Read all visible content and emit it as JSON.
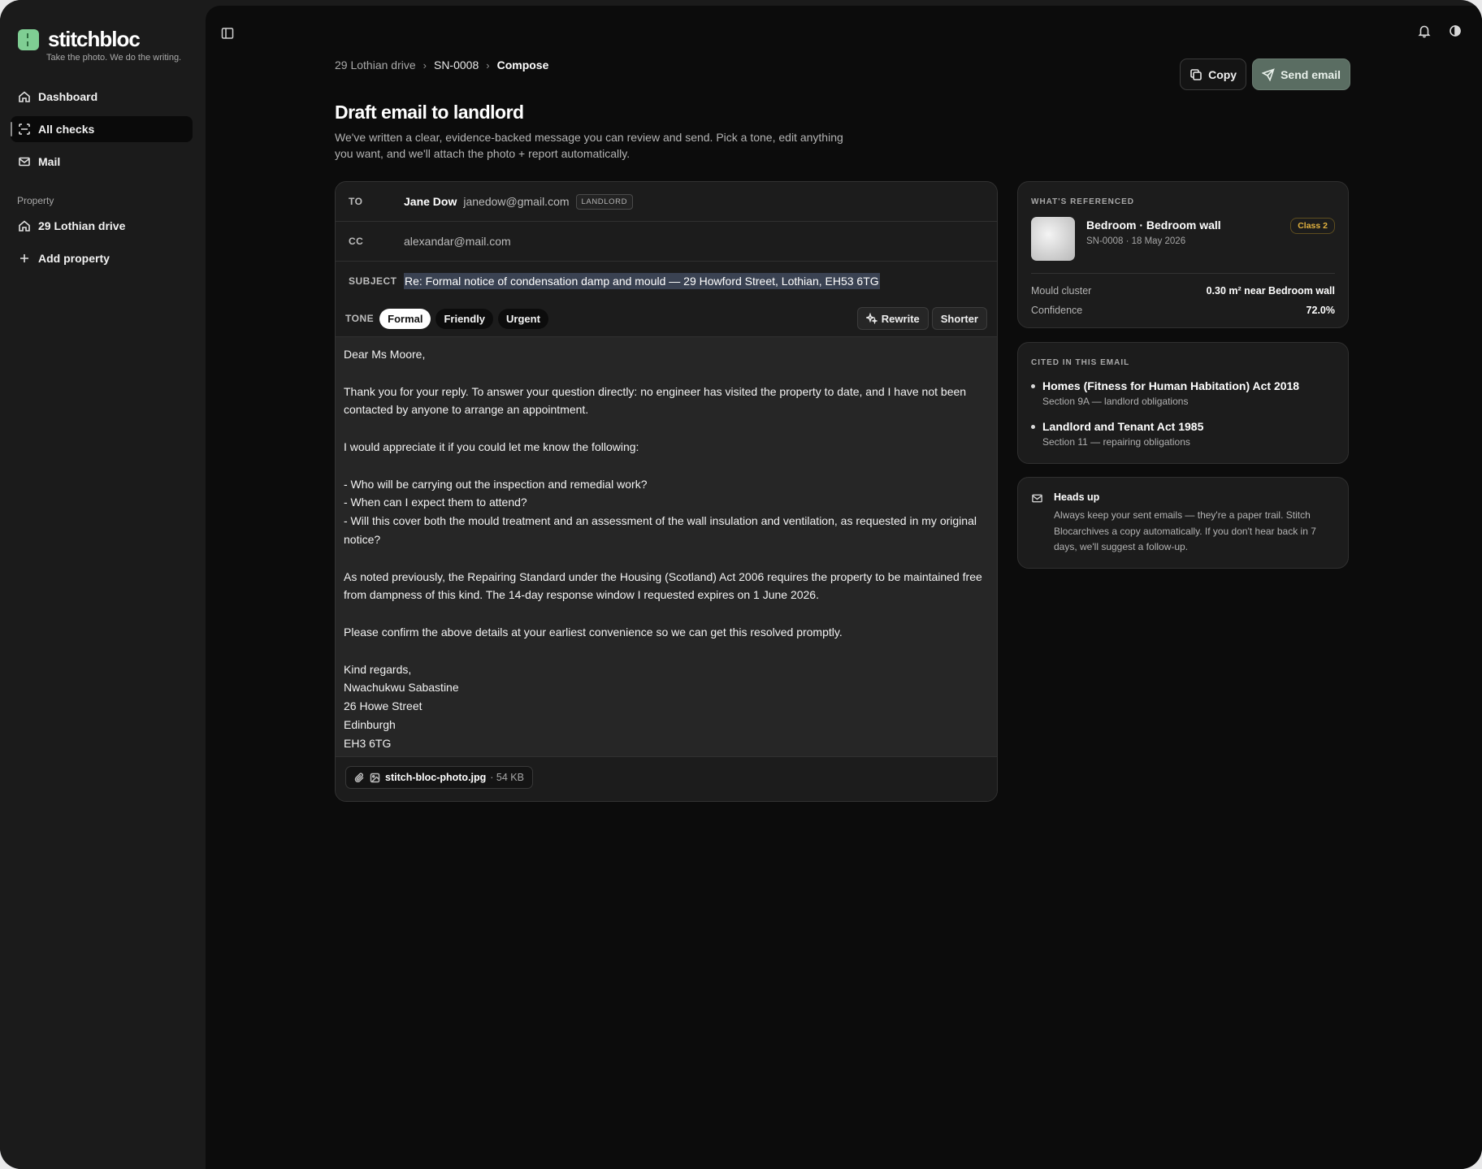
{
  "brand": {
    "name": "stitchbloc",
    "tagline": "Take the photo. We do the writing."
  },
  "sidebar": {
    "items": [
      {
        "label": "Dashboard",
        "icon": "home-icon"
      },
      {
        "label": "All checks",
        "icon": "scan-icon",
        "active": true
      },
      {
        "label": "Mail",
        "icon": "mail-icon"
      }
    ],
    "section_label": "Property",
    "property_items": [
      {
        "label": "29 Lothian drive",
        "icon": "home-icon"
      },
      {
        "label": "Add property",
        "icon": "plus-icon"
      }
    ]
  },
  "breadcrumb": [
    "29 Lothian drive",
    "SN-0008",
    "Compose"
  ],
  "toolbar": {
    "copy_label": "Copy",
    "send_label": "Send email"
  },
  "page": {
    "title": "Draft email to landlord",
    "subtitle": "We've written a clear, evidence-backed message you can review and send. Pick a tone, edit anything you want, and we'll attach the photo + report automatically."
  },
  "email": {
    "to_label": "TO",
    "to_name": "Jane Dow",
    "to_email": "janedow@gmail.com",
    "to_badge": "LANDLORD",
    "cc_label": "CC",
    "cc_email": "alexandar@mail.com",
    "subject_label": "SUBJECT",
    "subject": "Re: Formal notice of condensation damp and mould — 29 Howford Street, Lothian, EH53 6TG",
    "tone_label": "TONE",
    "tones": [
      "Formal",
      "Friendly",
      "Urgent"
    ],
    "selected_tone": "Formal",
    "rewrite_label": "Rewrite",
    "shorter_label": "Shorter",
    "body": "Dear Ms Moore,\n\nThank you for your reply. To answer your question directly: no engineer has visited the property to date, and I have not been contacted by anyone to arrange an appointment.\n\nI would appreciate it if you could let me know the following:\n\n- Who will be carrying out the inspection and remedial work?\n- When can I expect them to attend?\n- Will this cover both the mould treatment and an assessment of the wall insulation and ventilation, as requested in my original notice?\n\nAs noted previously, the Repairing Standard under the Housing (Scotland) Act 2006 requires the property to be maintained free from dampness of this kind. The 14-day response window I requested expires on 1 June 2026.\n\nPlease confirm the above details at your earliest convenience so we can get this resolved promptly.\n\nKind regards,\nNwachukwu Sabastine\n26 Howe Street\nEdinburgh\nEH3 6TG",
    "attachment": {
      "filename": "stitch-bloc-photo.jpg",
      "size": "· 54 KB"
    }
  },
  "referenced": {
    "heading": "WHAT'S REFERENCED",
    "title": "Bedroom · Bedroom wall",
    "subtitle": "SN-0008 · 18 May 2026",
    "class_badge": "Class 2",
    "mould_label": "Mould cluster",
    "mould_value": "0.30 m² near Bedroom wall",
    "confidence_label": "Confidence",
    "confidence_value": "72.0%"
  },
  "cited": {
    "heading": "CITED IN THIS EMAIL",
    "items": [
      {
        "title": "Homes (Fitness for Human Habitation) Act 2018",
        "sub": "Section 9A — landlord obligations"
      },
      {
        "title": "Landlord and Tenant Act 1985",
        "sub": "Section 11 — repairing obligations"
      }
    ]
  },
  "heads_up": {
    "title": "Heads up",
    "text": "Always keep your sent emails — they're a paper trail. Stitch Blocarchives a copy automatically. If you don't hear back in 7 days, we'll suggest a follow-up."
  }
}
